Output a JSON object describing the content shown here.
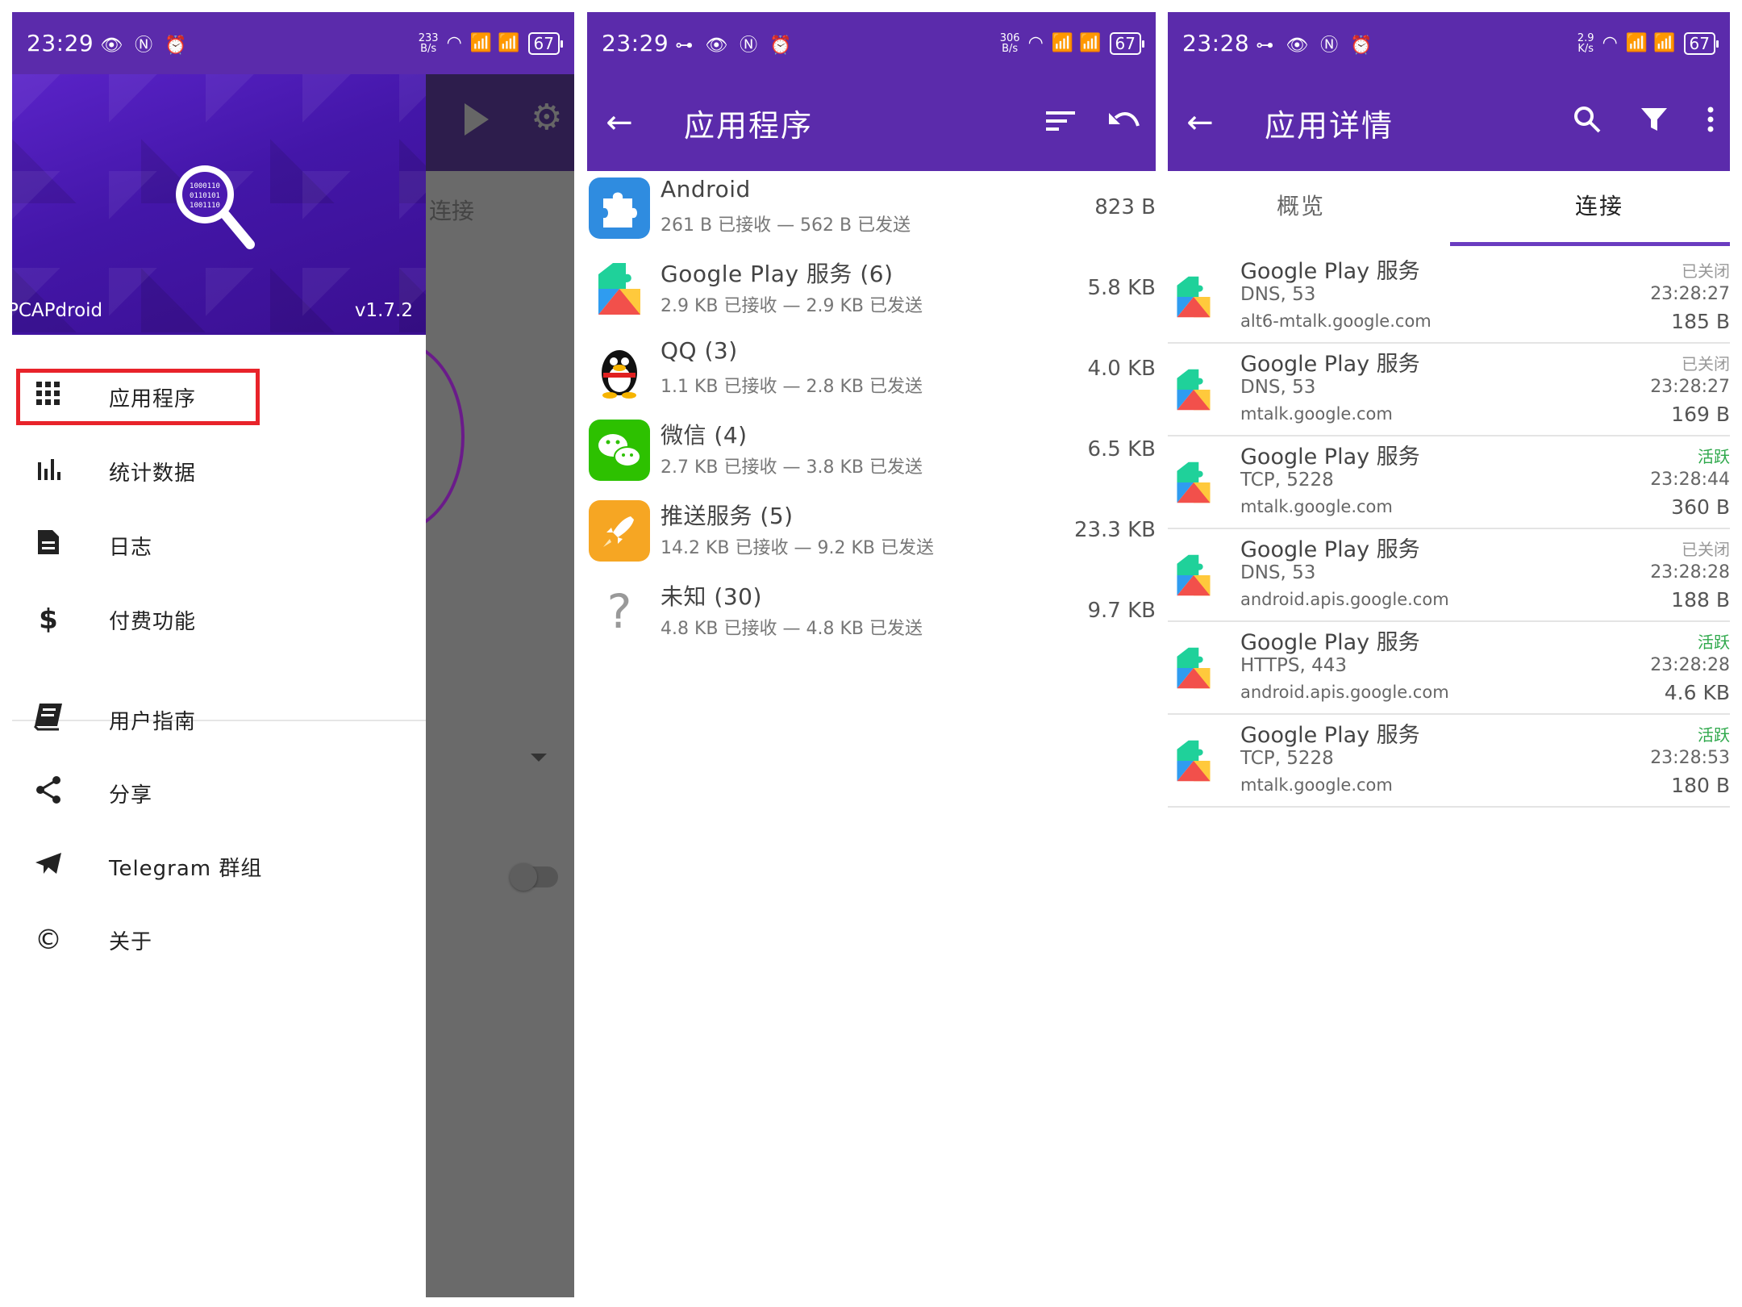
{
  "panels": [
    {
      "status": {
        "time": "23:29",
        "icons": "👁 Ⓝ ⏰",
        "net_speed": "233\nB/s",
        "signal": "📶 📶",
        "battery": "67"
      },
      "drawer": {
        "app_name": "PCAPdroid",
        "version": "v1.7.2",
        "items": [
          {
            "label": "应用程序",
            "icon": "grid-icon"
          },
          {
            "label": "统计数据",
            "icon": "bar-chart-icon"
          },
          {
            "label": "日志",
            "icon": "document-icon"
          },
          {
            "label": "付费功能",
            "icon": "dollar-icon"
          },
          {
            "label": "用户指南",
            "icon": "book-icon"
          },
          {
            "label": "分享",
            "icon": "share-icon"
          },
          {
            "label": "Telegram 群组",
            "icon": "telegram-icon"
          },
          {
            "label": "关于",
            "icon": "copyright-icon"
          }
        ]
      },
      "background": {
        "tab_partial": "连接"
      }
    },
    {
      "status": {
        "time": "23:29",
        "icons": "⊶ 👁 Ⓝ ⏰",
        "net_speed": "306\nB/s",
        "signal": "📶 📶",
        "battery": "67"
      },
      "appbar": {
        "title": "应用程序",
        "back_icon": "back-arrow-icon",
        "actions": [
          "sort-icon",
          "undo-icon"
        ]
      },
      "apps": [
        {
          "name": "Android",
          "sub": "261 B 已接收 — 562 B 已发送",
          "size": "823 B",
          "icon": "puzzle-icon",
          "color": "#2f8ce0"
        },
        {
          "name": "Google Play 服务 (6)",
          "sub": "2.9 KB 已接收 — 2.9 KB 已发送",
          "size": "5.8 KB",
          "icon": "google-play-services-icon",
          "color": "#ffffff"
        },
        {
          "name": "QQ (3)",
          "sub": "1.1 KB 已接收 — 2.8 KB 已发送",
          "size": "4.0 KB",
          "icon": "qq-penguin-icon",
          "color": "#ffffff"
        },
        {
          "name": "微信 (4)",
          "sub": "2.7 KB 已接收 — 3.8 KB 已发送",
          "size": "6.5 KB",
          "icon": "wechat-icon",
          "color": "#2dc100"
        },
        {
          "name": "推送服务 (5)",
          "sub": "14.2 KB 已接收 — 9.2 KB 已发送",
          "size": "23.3 KB",
          "icon": "rocket-icon",
          "color": "#f6a623"
        },
        {
          "name": "未知 (30)",
          "sub": "4.8 KB 已接收 — 4.8 KB 已发送",
          "size": "9.7 KB",
          "icon": "question-icon",
          "color": "#ffffff"
        }
      ]
    },
    {
      "status": {
        "time": "23:28",
        "icons": "⊶ 👁 Ⓝ ⏰",
        "net_speed": "2.9\nK/s",
        "signal": "📶 📶",
        "battery": "67"
      },
      "appbar": {
        "title": "应用详情",
        "back_icon": "back-arrow-icon",
        "actions": [
          "search-icon",
          "filter-icon",
          "more-vert-icon"
        ]
      },
      "tabs": [
        {
          "label": "概览",
          "selected": false
        },
        {
          "label": "连接",
          "selected": true
        }
      ],
      "connections": [
        {
          "app": "Google Play 服务",
          "proto": "DNS, 53",
          "host": "alt6-mtalk.google.com",
          "status": "已关闭",
          "active": false,
          "time": "23:28:27",
          "bytes": "185 B"
        },
        {
          "app": "Google Play 服务",
          "proto": "DNS, 53",
          "host": "mtalk.google.com",
          "status": "已关闭",
          "active": false,
          "time": "23:28:27",
          "bytes": "169 B"
        },
        {
          "app": "Google Play 服务",
          "proto": "TCP, 5228",
          "host": "mtalk.google.com",
          "status": "活跃",
          "active": true,
          "time": "23:28:44",
          "bytes": "360 B"
        },
        {
          "app": "Google Play 服务",
          "proto": "DNS, 53",
          "host": "android.apis.google.com",
          "status": "已关闭",
          "active": false,
          "time": "23:28:28",
          "bytes": "188 B"
        },
        {
          "app": "Google Play 服务",
          "proto": "HTTPS, 443",
          "host": "android.apis.google.com",
          "status": "活跃",
          "active": true,
          "time": "23:28:28",
          "bytes": "4.6 KB"
        },
        {
          "app": "Google Play 服务",
          "proto": "TCP, 5228",
          "host": "mtalk.google.com",
          "status": "活跃",
          "active": true,
          "time": "23:28:53",
          "bytes": "180 B"
        }
      ]
    }
  ],
  "colors": {
    "primary": "#5b2bab",
    "highlight": "#e8232a",
    "active": "#2ea84b"
  }
}
